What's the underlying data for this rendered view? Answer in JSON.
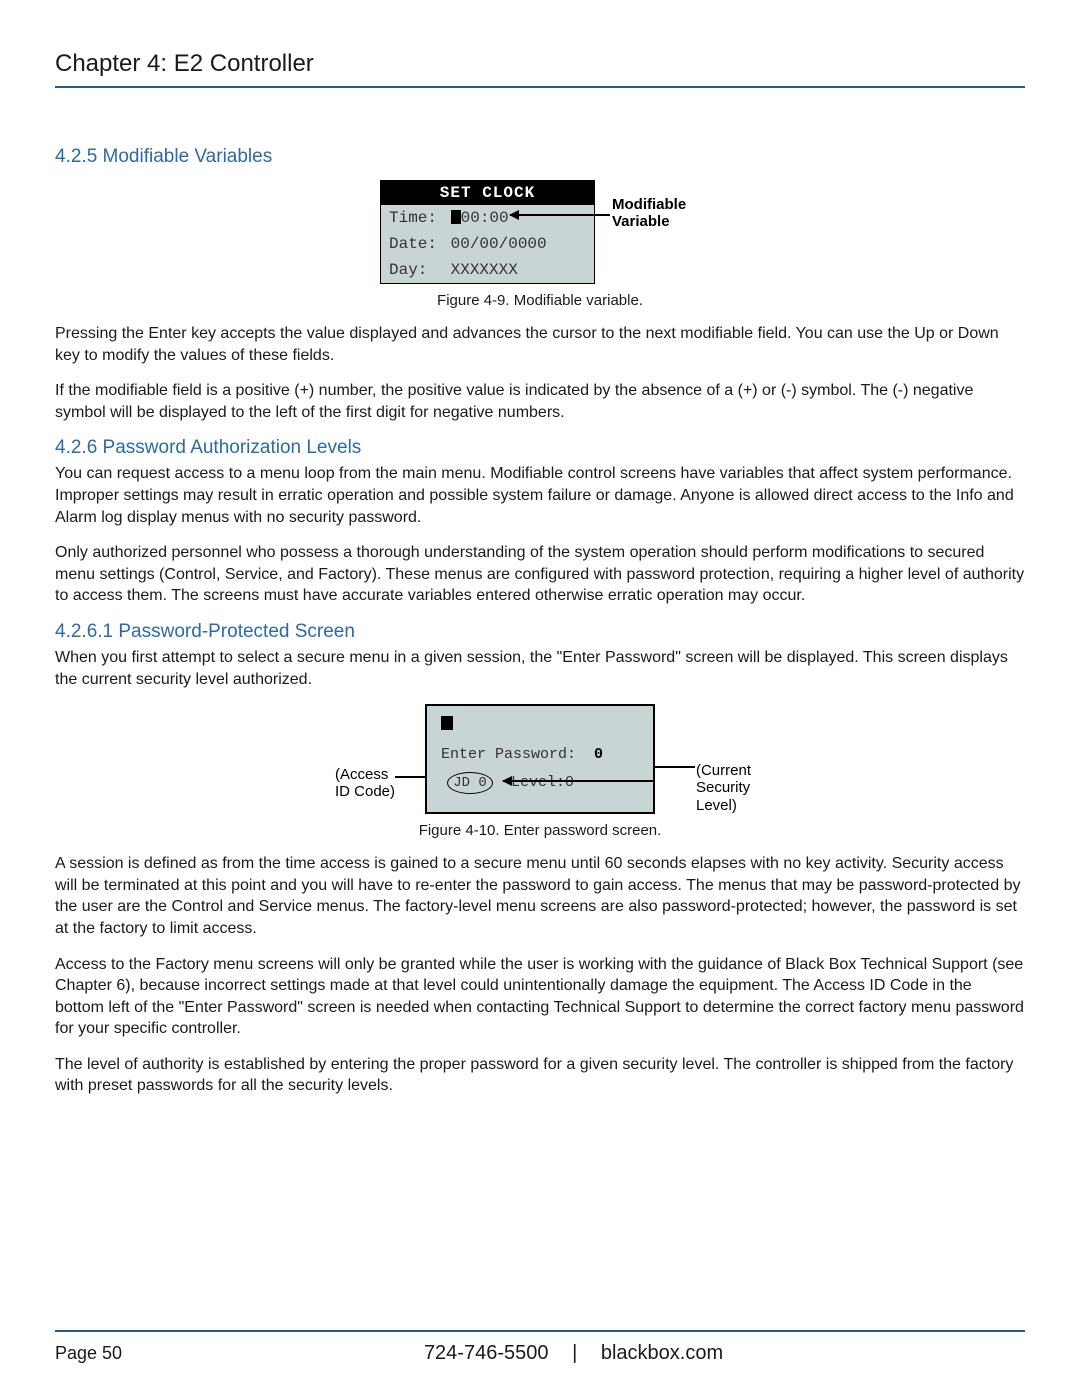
{
  "chapter_title": "Chapter 4: E2 Controller",
  "section_425": {
    "heading": "4.2.5 Modifiable Variables",
    "figure": {
      "title": "SET CLOCK",
      "rows": {
        "time": {
          "label": "Time:",
          "value": "00:00"
        },
        "date": {
          "label": "Date:",
          "value": "00/00/0000"
        },
        "day": {
          "label": "Day:",
          "value": "XXXXXXX"
        }
      },
      "annotation": "Modifiable\nVariable",
      "caption": "Figure 4-9. Modifiable variable."
    },
    "para1": "Pressing the Enter key accepts the value displayed and advances the cursor to the next modifiable field. You can use the Up or Down key to modify the values of these fields.",
    "para2": "If the modifiable field is a positive (+) number, the positive value is indicated by the absence of a (+) or (-) symbol. The (-) negative symbol will be displayed to the left of the first digit for negative numbers."
  },
  "section_426": {
    "heading": "4.2.6 Password Authorization Levels",
    "para1": "You can request access to a menu loop from the main menu. Modifiable control screens have variables that affect system performance. Improper settings may result in erratic operation and possible system failure or damage. Anyone is allowed direct access to the Info and Alarm log display menus with no security password.",
    "para2": "Only authorized personnel who possess a thorough understanding of the system operation should perform modifications to secured menu settings (Control, Service, and Factory). These menus are configured with password protection, requiring a higher level of authority to access them. The screens must have accurate variables entered otherwise erratic operation may occur."
  },
  "section_4261": {
    "heading": "4.2.6.1 Password-Protected Screen",
    "para1": "When you first attempt to select a secure menu in a given session, the \"Enter Password\" screen will be displayed. This screen displays the current security level authorized.",
    "figure": {
      "line1_label": "Enter Password:",
      "line1_value": "0",
      "jd": "JD 0",
      "level": "Level:0",
      "annot_left": "(Access\nID Code)",
      "annot_right": "(Current\nSecurity\nLevel)",
      "caption": "Figure 4-10. Enter password screen."
    },
    "para2": "A session is defined as from the time access is gained to a secure menu until 60 seconds elapses with no key activity. Security access will be terminated at this point and you will have to re-enter the password to gain access. The menus that may be password-protected by the user are the Control and Service menus. The factory-level menu screens are also password-protected; however, the password is set at the factory to limit access.",
    "para3": "Access to the Factory menu screens will only be granted while the user is working with the guidance of Black Box Technical Support (see Chapter 6), because incorrect settings made at that level could unintentionally damage the equipment. The Access ID Code in the bottom left of the \"Enter Password\" screen is needed when contacting Technical Support to determine the correct factory menu password for your specific controller.",
    "para4": "The level of authority is established by entering the proper password for a given security level. The controller is shipped from the factory with preset passwords for all the security levels."
  },
  "footer": {
    "page": "Page 50",
    "phone": "724-746-5500",
    "site": "blackbox.com",
    "separator": "|"
  }
}
